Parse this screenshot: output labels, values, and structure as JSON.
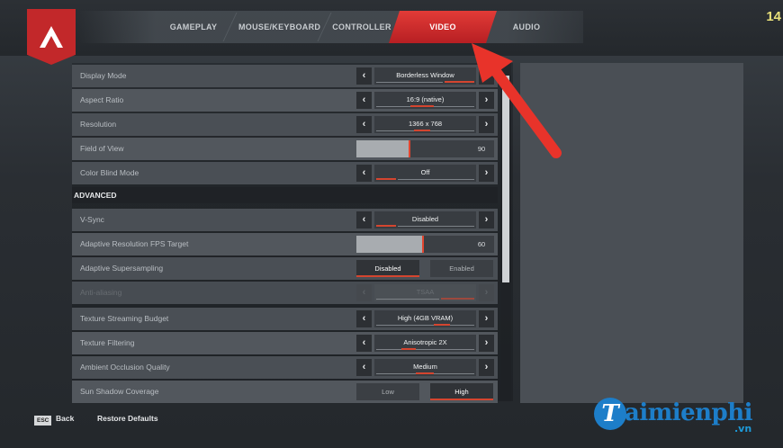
{
  "tabs": [
    {
      "label": "GAMEPLAY"
    },
    {
      "label": "MOUSE/KEYBOARD"
    },
    {
      "label": "CONTROLLER"
    },
    {
      "label": "VIDEO",
      "active": true
    },
    {
      "label": "AUDIO"
    }
  ],
  "corner_number": "14",
  "settings": {
    "display_mode": {
      "label": "Display Mode",
      "value": "Borderless Window"
    },
    "aspect_ratio": {
      "label": "Aspect Ratio",
      "value": "16:9 (native)"
    },
    "resolution": {
      "label": "Resolution",
      "value": "1366 x 768"
    },
    "fov": {
      "label": "Field of View",
      "value": "90",
      "fill": 0.48
    },
    "color_blind": {
      "label": "Color Blind Mode",
      "value": "Off"
    },
    "advanced_header": "ADVANCED",
    "vsync": {
      "label": "V-Sync",
      "value": "Disabled"
    },
    "adaptive_fps": {
      "label": "Adaptive Resolution FPS Target",
      "value": "60",
      "fill": 0.6
    },
    "adaptive_ss": {
      "label": "Adaptive Supersampling",
      "option_a": "Disabled",
      "option_b": "Enabled"
    },
    "anti_aliasing": {
      "label": "Anti-aliasing",
      "value": "TSAA"
    },
    "texture_budget": {
      "label": "Texture Streaming Budget",
      "value": "High (4GB VRAM)"
    },
    "texture_filtering": {
      "label": "Texture Filtering",
      "value": "Anisotropic 2X"
    },
    "ambient_occlusion": {
      "label": "Ambient Occlusion Quality",
      "value": "Medium"
    },
    "sun_shadow": {
      "label": "Sun Shadow Coverage",
      "option_a": "Low",
      "option_b": "High"
    }
  },
  "footer": {
    "esc_key": "ESC",
    "back": "Back",
    "restore": "Restore Defaults"
  },
  "watermark": {
    "mark": "T",
    "text": "aimienphi",
    "sub": ".vn"
  },
  "colors": {
    "accent": "#d4452f",
    "tab_active": "#c2282a",
    "watermark": "#1d7ec9"
  },
  "icons": {
    "logo": "apex-logo-icon",
    "left": "chevron-left-icon",
    "right": "chevron-right-icon",
    "annotation": "red-arrow-annotation"
  }
}
